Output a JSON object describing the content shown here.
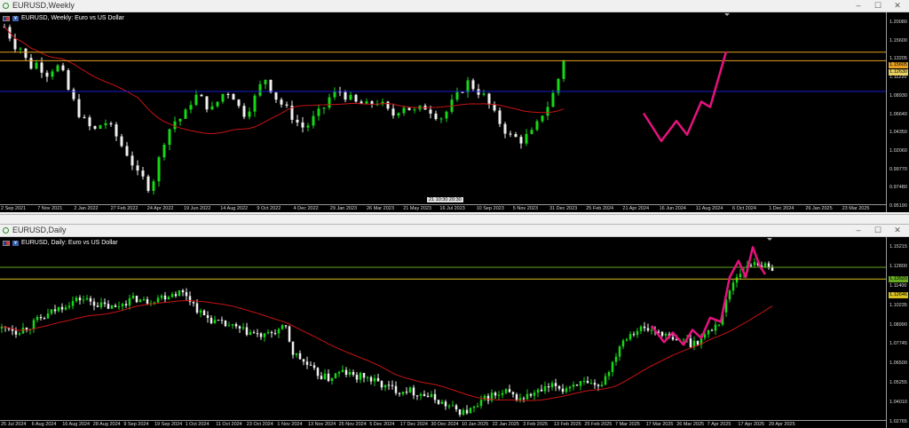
{
  "weekly": {
    "window_title": "EURUSD,Weekly",
    "legend_text": "EURUSD, Weekly: Euro vs US Dollar",
    "price_ticks": [
      "1.20080",
      "1.15600",
      "1.13205",
      "1.11220",
      "1.08930",
      "1.06640",
      "1.04350",
      "1.02060",
      "0.99770",
      "0.97480",
      "0.95190"
    ],
    "price_tags": [
      "1.15605",
      "1.12630"
    ],
    "date_ticks": [
      "2 Sep 2021",
      "7 Nov 2021",
      "2 Jan 2022",
      "27 Feb 2022",
      "24 Apr 2022",
      "19 Jun 2022",
      "14 Aug 2022",
      "9 Oct 2022",
      "4 Dec 2022",
      "29 Jan 2023",
      "26 Mar 2023",
      "21 May 2023",
      "16 Jul 2023",
      "10 Sep 2023",
      "5 Nov 2023",
      "31 Dec 2023",
      "25 Feb 2024",
      "21 Apr 2024",
      "16 Jun 2024",
      "11 Aug 2024",
      "6 Oct 2024",
      "1 Dec 2024",
      "26 Jan 2025",
      "23 Mar 2025"
    ],
    "crosshair_label": "21 10:30",
    "crosshair_label2": "20:30"
  },
  "daily": {
    "window_title": "EURUSD,Daily",
    "legend_text": "EURUSD, Daily: Euro vs US Dollar",
    "price_ticks": [
      "1.15215",
      "1.12800",
      "1.11400",
      "1.10235",
      "1.08990",
      "1.07745",
      "1.06500",
      "1.05255",
      "1.04010",
      "1.02765"
    ],
    "price_tags": [
      "1.13520",
      "1.12646"
    ],
    "date_ticks": [
      "25 Jul 2024",
      "6 Aug 2024",
      "16 Aug 2024",
      "28 Aug 2024",
      "9 Sep 2024",
      "19 Sep 2024",
      "1 Oct 2024",
      "11 Oct 2024",
      "23 Oct 2024",
      "1 Nov 2024",
      "13 Nov 2024",
      "25 Nov 2024",
      "5 Dec 2024",
      "17 Dec 2024",
      "30 Dec 2024",
      "10 Jan 2025",
      "22 Jan 2025",
      "3 Feb 2025",
      "13 Feb 2025",
      "25 Feb 2025",
      "7 Mar 2025",
      "17 Mar 2025",
      "26 Mar 2025",
      "7 Apr 2025",
      "17 Apr 2025",
      "29 Apr 2025"
    ]
  },
  "controls": {
    "minimize": "–",
    "maximize": "☐",
    "close": "✕"
  },
  "colors": {
    "bull": "#16d816",
    "bear": "#f0f0f0",
    "ma": "#c81414",
    "zigzag": "#e8117f",
    "level_orange": "#e8a020",
    "level_blue": "#1a1ad8",
    "level_green": "#66aa22",
    "level_yellow": "#d8c020"
  },
  "chart_data": [
    {
      "type": "candlestick",
      "title": "EURUSD, Weekly: Euro vs US Dollar",
      "x_range": [
        "2 Sep 2021",
        "Apr 2025"
      ],
      "ylim": [
        0.9519,
        1.2008
      ],
      "path": [
        [
          0,
          1.182
        ],
        [
          6,
          1.17
        ],
        [
          12,
          1.158
        ],
        [
          18,
          1.155
        ],
        [
          24,
          1.14
        ],
        [
          30,
          1.131
        ],
        [
          36,
          1.135
        ],
        [
          42,
          1.128
        ],
        [
          48,
          1.122
        ],
        [
          54,
          1.128
        ],
        [
          60,
          1.13
        ],
        [
          66,
          1.12
        ],
        [
          72,
          1.1
        ],
        [
          78,
          1.085
        ],
        [
          84,
          1.07
        ],
        [
          90,
          1.06
        ],
        [
          96,
          1.052
        ],
        [
          102,
          1.048
        ],
        [
          108,
          1.055
        ],
        [
          114,
          1.058
        ],
        [
          120,
          1.05
        ],
        [
          126,
          1.04
        ],
        [
          132,
          1.028
        ],
        [
          138,
          1.018
        ],
        [
          144,
          1.005
        ],
        [
          150,
          0.99
        ],
        [
          156,
          0.985
        ],
        [
          162,
          0.975
        ],
        [
          168,
          0.985
        ],
        [
          174,
          1.01
        ],
        [
          180,
          1.035
        ],
        [
          186,
          1.05
        ],
        [
          192,
          1.06
        ],
        [
          198,
          1.063
        ],
        [
          204,
          1.07
        ],
        [
          210,
          1.085
        ],
        [
          216,
          1.092
        ],
        [
          222,
          1.088
        ],
        [
          228,
          1.08
        ],
        [
          234,
          1.075
        ],
        [
          240,
          1.085
        ],
        [
          246,
          1.095
        ],
        [
          252,
          1.098
        ],
        [
          258,
          1.092
        ],
        [
          264,
          1.078
        ],
        [
          270,
          1.07
        ],
        [
          276,
          1.078
        ],
        [
          282,
          1.09
        ],
        [
          288,
          1.105
        ],
        [
          294,
          1.115
        ],
        [
          300,
          1.102
        ],
        [
          306,
          1.09
        ],
        [
          312,
          1.082
        ],
        [
          318,
          1.075
        ],
        [
          324,
          1.066
        ],
        [
          330,
          1.058
        ],
        [
          336,
          1.052
        ],
        [
          342,
          1.055
        ],
        [
          348,
          1.063
        ],
        [
          354,
          1.07
        ],
        [
          360,
          1.078
        ],
        [
          366,
          1.09
        ],
        [
          372,
          1.095
        ],
        [
          378,
          1.098
        ],
        [
          384,
          1.093
        ],
        [
          390,
          1.088
        ],
        [
          396,
          1.083
        ],
        [
          402,
          1.082
        ],
        [
          408,
          1.08
        ],
        [
          414,
          1.083
        ],
        [
          420,
          1.085
        ],
        [
          426,
          1.08
        ],
        [
          432,
          1.072
        ],
        [
          438,
          1.068
        ],
        [
          444,
          1.075
        ],
        [
          450,
          1.08
        ],
        [
          456,
          1.076
        ],
        [
          462,
          1.072
        ],
        [
          468,
          1.075
        ],
        [
          474,
          1.078
        ],
        [
          480,
          1.074
        ],
        [
          486,
          1.068
        ],
        [
          492,
          1.065
        ],
        [
          498,
          1.072
        ],
        [
          504,
          1.083
        ],
        [
          510,
          1.092
        ],
        [
          516,
          1.102
        ],
        [
          522,
          1.11
        ],
        [
          528,
          1.104
        ],
        [
          534,
          1.098
        ],
        [
          540,
          1.092
        ],
        [
          546,
          1.08
        ],
        [
          552,
          1.068
        ],
        [
          558,
          1.058
        ],
        [
          564,
          1.048
        ],
        [
          570,
          1.04
        ],
        [
          576,
          1.038
        ],
        [
          582,
          1.035
        ],
        [
          588,
          1.04
        ],
        [
          594,
          1.044
        ],
        [
          600,
          1.055
        ],
        [
          606,
          1.07
        ],
        [
          612,
          1.08
        ],
        [
          618,
          1.095
        ],
        [
          624,
          1.115
        ],
        [
          630,
          1.14
        ]
      ]
    },
    {
      "type": "candlestick",
      "title": "EURUSD, Daily: Euro vs US Dollar",
      "x_range": [
        "25 Jul 2024",
        "29 Apr 2025"
      ],
      "ylim": [
        1.0225,
        1.1575
      ],
      "path": [
        [
          0,
          1.09
        ],
        [
          8,
          1.091
        ],
        [
          16,
          1.088
        ],
        [
          24,
          1.09
        ],
        [
          32,
          1.092
        ],
        [
          40,
          1.096
        ],
        [
          48,
          1.098
        ],
        [
          56,
          1.102
        ],
        [
          64,
          1.105
        ],
        [
          72,
          1.108
        ],
        [
          80,
          1.11
        ],
        [
          88,
          1.112
        ],
        [
          96,
          1.111
        ],
        [
          104,
          1.109
        ],
        [
          112,
          1.107
        ],
        [
          120,
          1.106
        ],
        [
          128,
          1.105
        ],
        [
          136,
          1.109
        ],
        [
          144,
          1.111
        ],
        [
          152,
          1.112
        ],
        [
          160,
          1.11
        ],
        [
          168,
          1.111
        ],
        [
          176,
          1.113
        ],
        [
          184,
          1.114
        ],
        [
          192,
          1.116
        ],
        [
          200,
          1.117
        ],
        [
          208,
          1.115
        ],
        [
          216,
          1.108
        ],
        [
          224,
          1.101
        ],
        [
          232,
          1.098
        ],
        [
          240,
          1.095
        ],
        [
          248,
          1.093
        ],
        [
          256,
          1.092
        ],
        [
          264,
          1.09
        ],
        [
          272,
          1.088
        ],
        [
          280,
          1.087
        ],
        [
          288,
          1.085
        ],
        [
          296,
          1.084
        ],
        [
          304,
          1.087
        ],
        [
          312,
          1.089
        ],
        [
          320,
          1.09
        ],
        [
          328,
          1.072
        ],
        [
          336,
          1.068
        ],
        [
          344,
          1.063
        ],
        [
          352,
          1.058
        ],
        [
          360,
          1.055
        ],
        [
          368,
          1.053
        ],
        [
          376,
          1.056
        ],
        [
          384,
          1.058
        ],
        [
          392,
          1.056
        ],
        [
          400,
          1.054
        ],
        [
          408,
          1.055
        ],
        [
          416,
          1.052
        ],
        [
          424,
          1.05
        ],
        [
          432,
          1.047
        ],
        [
          440,
          1.046
        ],
        [
          448,
          1.044
        ],
        [
          456,
          1.045
        ],
        [
          464,
          1.043
        ],
        [
          472,
          1.042
        ],
        [
          480,
          1.04
        ],
        [
          488,
          1.038
        ],
        [
          496,
          1.035
        ],
        [
          504,
          1.032
        ],
        [
          512,
          1.03
        ],
        [
          520,
          1.028
        ],
        [
          528,
          1.03
        ],
        [
          536,
          1.032
        ],
        [
          544,
          1.038
        ],
        [
          552,
          1.041
        ],
        [
          560,
          1.04
        ],
        [
          568,
          1.043
        ],
        [
          576,
          1.04
        ],
        [
          584,
          1.038
        ],
        [
          592,
          1.04
        ],
        [
          600,
          1.042
        ],
        [
          608,
          1.044
        ],
        [
          616,
          1.046
        ],
        [
          624,
          1.048
        ],
        [
          632,
          1.045
        ],
        [
          640,
          1.048
        ],
        [
          648,
          1.05
        ],
        [
          656,
          1.049
        ],
        [
          664,
          1.047
        ],
        [
          672,
          1.046
        ],
        [
          680,
          1.055
        ],
        [
          688,
          1.065
        ],
        [
          696,
          1.078
        ],
        [
          704,
          1.085
        ],
        [
          712,
          1.088
        ],
        [
          720,
          1.09
        ],
        [
          728,
          1.089
        ],
        [
          736,
          1.088
        ],
        [
          744,
          1.087
        ],
        [
          752,
          1.082
        ],
        [
          760,
          1.08
        ],
        [
          768,
          1.083
        ],
        [
          776,
          1.079
        ],
        [
          784,
          1.081
        ],
        [
          792,
          1.085
        ],
        [
          800,
          1.09
        ],
        [
          808,
          1.095
        ],
        [
          816,
          1.11
        ],
        [
          824,
          1.125
        ],
        [
          832,
          1.132
        ],
        [
          840,
          1.135
        ],
        [
          848,
          1.14
        ],
        [
          856,
          1.137
        ],
        [
          864,
          1.134
        ],
        [
          870,
          1.136
        ]
      ]
    }
  ]
}
